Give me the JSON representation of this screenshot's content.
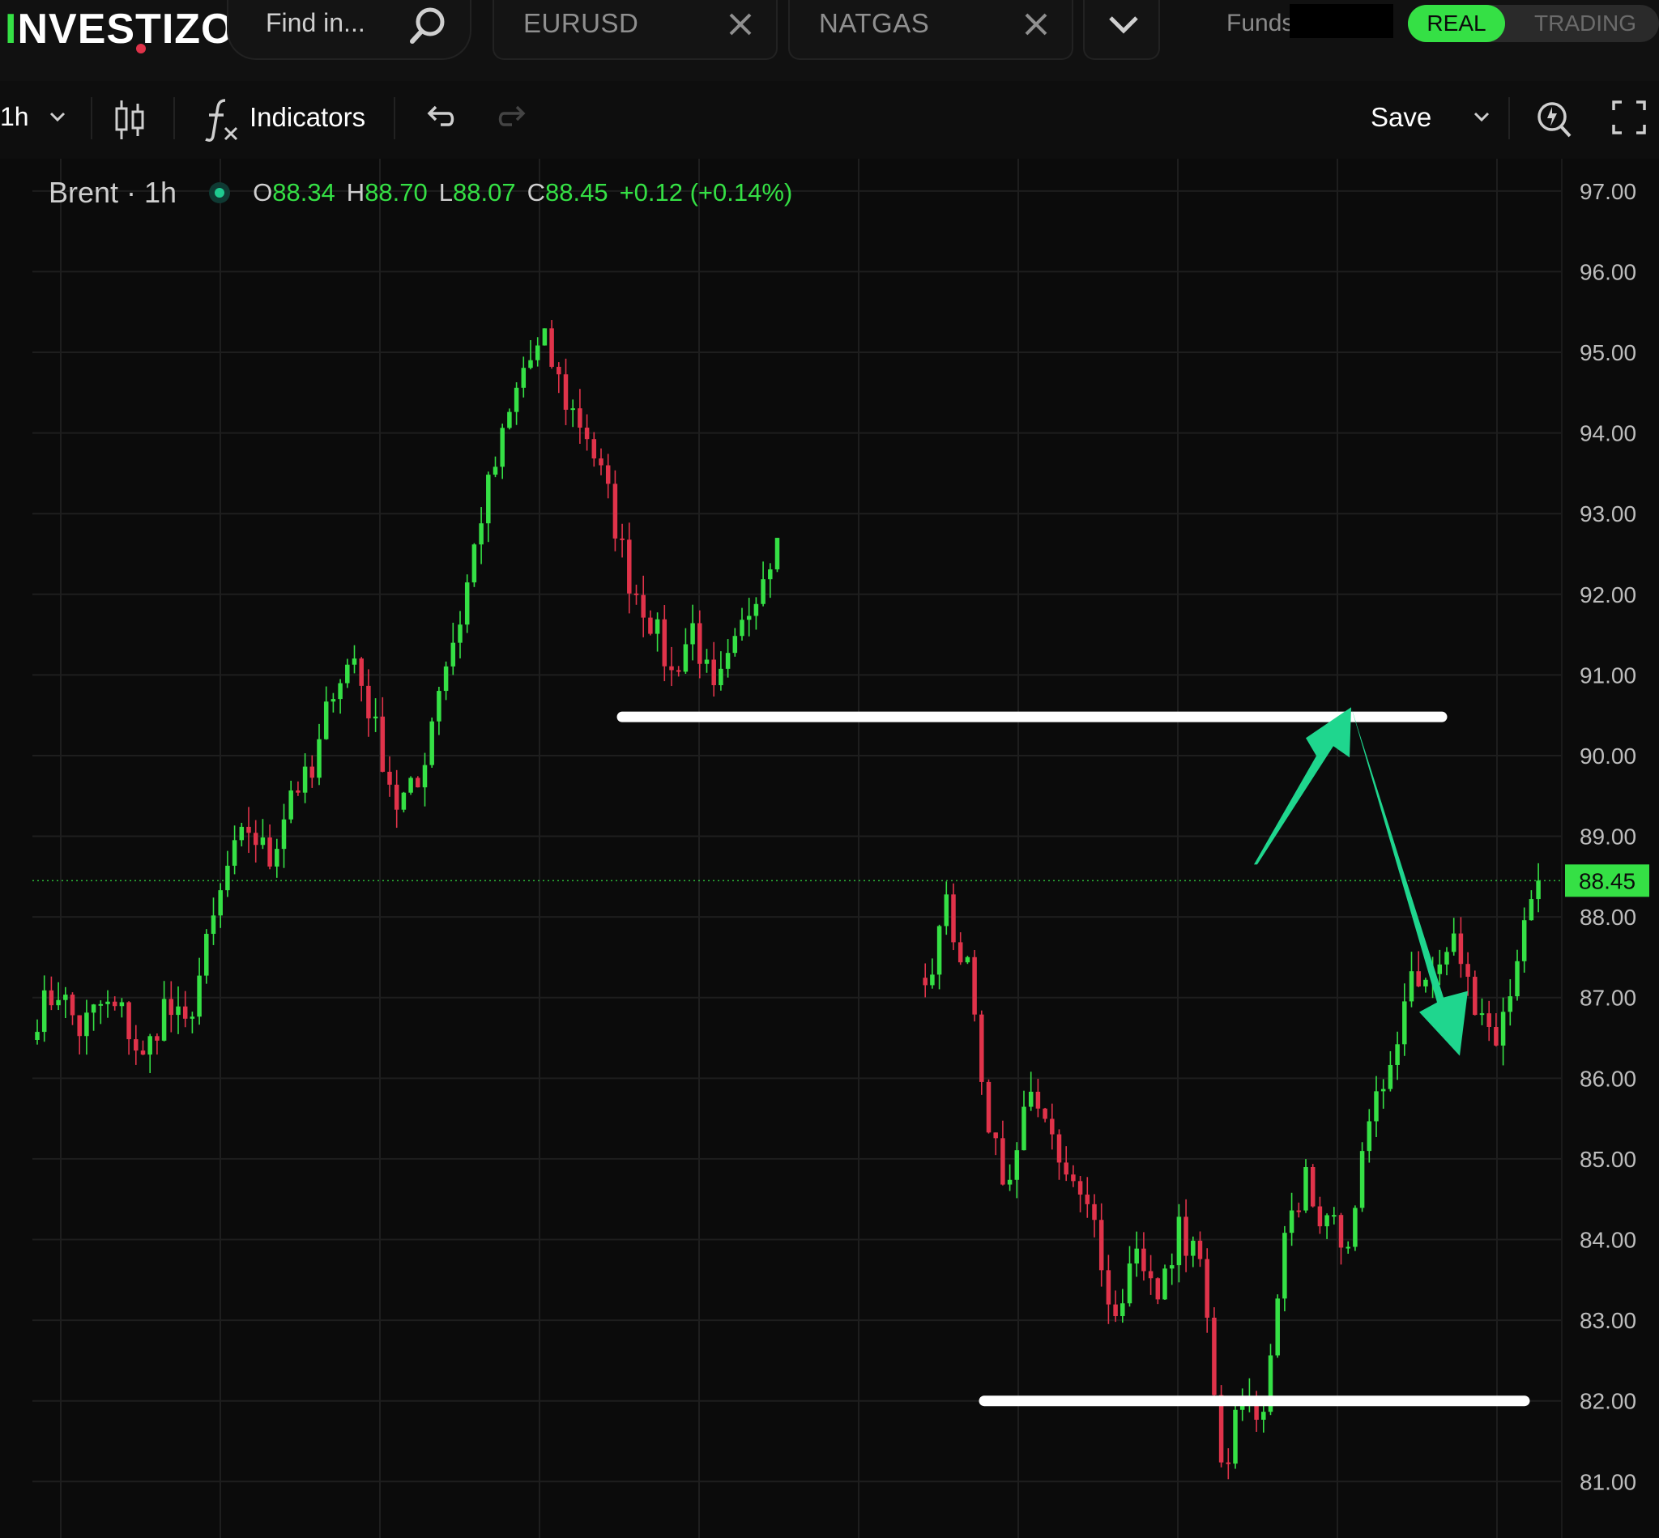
{
  "app": {
    "logo_text_accent": "I",
    "logo_text": "NVESTIZO"
  },
  "search": {
    "placeholder": "Find in..."
  },
  "tabs": [
    {
      "label": "EURUSD"
    },
    {
      "label": "NATGAS"
    }
  ],
  "account": {
    "funds_label": "Funds",
    "real_label": "REAL",
    "trading_label": "TRADING"
  },
  "toolbar": {
    "interval": "1h",
    "indicators_label": "Indicators",
    "save_label": "Save"
  },
  "legend": {
    "symbol": "Brent · 1h",
    "open_key": "O",
    "open": "88.34",
    "high_key": "H",
    "high": "88.70",
    "low_key": "L",
    "low": "88.07",
    "close_key": "C",
    "close": "88.45",
    "change": "+0.12 (+0.14%)"
  },
  "colors": {
    "background": "#0b0b0b",
    "up": "#35e045",
    "down": "#e0334a",
    "accent": "#35e045",
    "annotation_arrow": "#1fd68e",
    "annotation_line": "#ffffff"
  },
  "chart_data": {
    "type": "candlestick",
    "title": "Brent · 1h",
    "ylim": [
      80.3,
      97.4
    ],
    "y_ticks": [
      "97.00",
      "96.00",
      "95.00",
      "94.00",
      "93.00",
      "92.00",
      "91.00",
      "90.00",
      "89.00",
      "88.00",
      "87.00",
      "86.00",
      "85.00",
      "84.00",
      "83.00",
      "82.00",
      "81.00"
    ],
    "grid": true,
    "last_price": "88.45",
    "segments": [
      {
        "from": 0,
        "points": [
          86.8,
          87.1,
          86.6,
          86.9,
          86.8,
          86.2,
          86.9,
          86.6,
          87.6,
          88.6,
          89.1,
          88.7,
          89.6,
          89.7,
          90.9,
          91.2,
          90.3,
          89.4,
          89.6,
          90.9,
          91.7,
          93.0,
          93.9,
          94.8,
          95.1,
          94.4,
          94.0,
          93.2,
          92.2,
          91.7,
          91.0,
          91.6,
          90.7,
          91.3,
          92.1,
          92.7
        ]
      },
      {
        "from": 126,
        "points": [
          87.2,
          88.1,
          87.3,
          85.5,
          84.6,
          86.0,
          85.1,
          84.6,
          84.2,
          83.0,
          84.0,
          83.2,
          84.1,
          83.8,
          81.1,
          82.0,
          81.7,
          83.9,
          84.8,
          84.1,
          84.1,
          85.3,
          86.3,
          87.3,
          87.3,
          88.0,
          86.8,
          86.4,
          87.4,
          88.45
        ]
      }
    ],
    "candle_count": 216,
    "annotations": [
      {
        "type": "horizontal_line",
        "price": 90.48,
        "color": "#ffffff"
      },
      {
        "type": "horizontal_line",
        "price": 82.0,
        "color": "#ffffff"
      },
      {
        "type": "arrow",
        "direction": "up",
        "to_price": 90.6,
        "color": "#1fd68e"
      },
      {
        "type": "arrow",
        "direction": "down",
        "to_price": 86.6,
        "color": "#1fd68e"
      }
    ]
  }
}
